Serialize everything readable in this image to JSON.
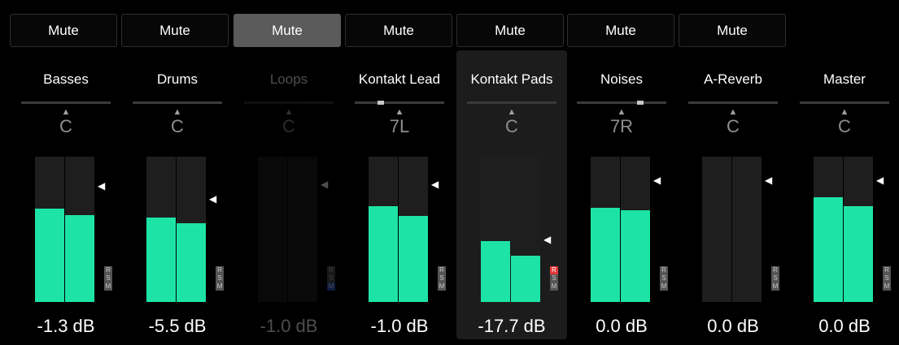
{
  "mute_label": "Mute",
  "colors": {
    "meter": "#1de4a6",
    "record_active": "#e23b3b",
    "monitor_active": "#2e5ad1"
  },
  "icons": {
    "pan_arrow": "up-triangle-icon",
    "fader_marker": "left-triangle-icon"
  },
  "channels": [
    {
      "name": "Basses",
      "pan": "C",
      "volume": "-1.3 dB",
      "level": [
        0.64,
        0.6
      ],
      "fader": 0.8,
      "mute_active": false,
      "rec": false,
      "mon": false,
      "selected": false,
      "dim": false
    },
    {
      "name": "Drums",
      "pan": "C",
      "volume": "-5.5 dB",
      "level": [
        0.58,
        0.54
      ],
      "fader": 0.71,
      "mute_active": false,
      "rec": false,
      "mon": false,
      "selected": false,
      "dim": false
    },
    {
      "name": "Loops",
      "pan": "C",
      "volume": "-1.0 dB",
      "level": [
        0.0,
        0.0
      ],
      "fader": 0.81,
      "mute_active": true,
      "rec": false,
      "mon": true,
      "selected": false,
      "dim": true
    },
    {
      "name": "Kontakt Lead",
      "pan": "7L",
      "volume": "-1.0 dB",
      "level": [
        0.66,
        0.59
      ],
      "fader": 0.81,
      "mute_active": false,
      "rec": false,
      "mon": false,
      "selected": false,
      "dim": false
    },
    {
      "name": "Kontakt Pads",
      "pan": "C",
      "volume": "-17.7 dB",
      "level": [
        0.42,
        0.32
      ],
      "fader": 0.43,
      "mute_active": false,
      "rec": true,
      "mon": false,
      "selected": true,
      "dim": false
    },
    {
      "name": "Noises",
      "pan": "7R",
      "volume": "0.0 dB",
      "level": [
        0.65,
        0.63
      ],
      "fader": 0.84,
      "mute_active": false,
      "rec": false,
      "mon": false,
      "selected": false,
      "dim": false
    },
    {
      "name": "A-Reverb",
      "pan": "C",
      "volume": "0.0 dB",
      "level": [
        0.0,
        0.0
      ],
      "fader": 0.84,
      "mute_active": false,
      "rec": false,
      "mon": false,
      "selected": false,
      "dim": false
    },
    {
      "name": "Master",
      "pan": "C",
      "volume": "0.0 dB",
      "level": [
        0.72,
        0.66
      ],
      "fader": 0.84,
      "mute_active": false,
      "rec": false,
      "mon": false,
      "selected": false,
      "dim": false
    }
  ],
  "rsm_labels": [
    "R",
    "S",
    "M"
  ]
}
